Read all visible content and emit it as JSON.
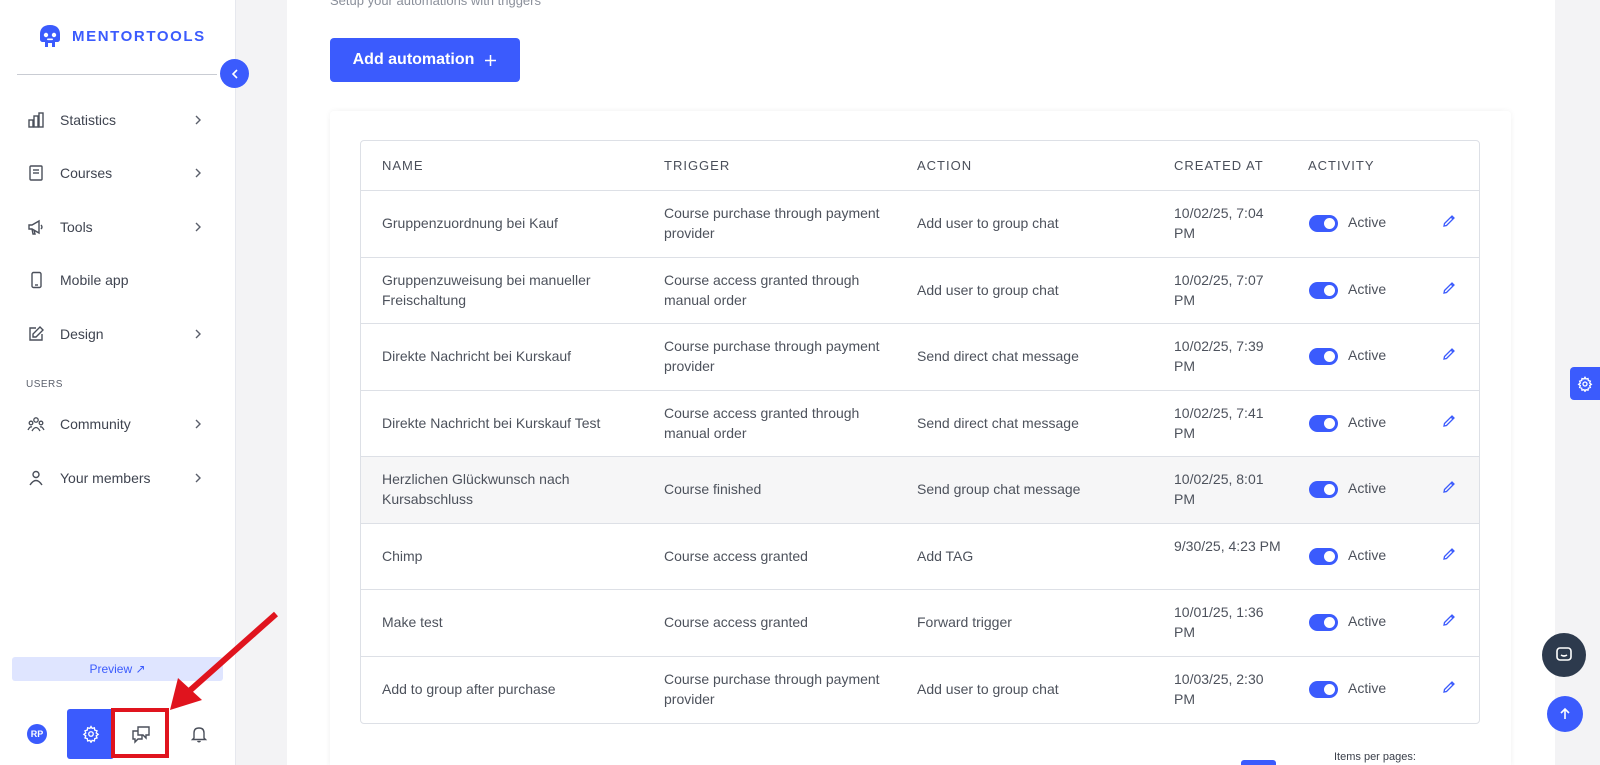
{
  "brand": {
    "name": "MENTORTOOLS",
    "color": "#3b5bfd"
  },
  "sidebar": {
    "items": [
      {
        "label": "Statistics",
        "icon": "bar-chart-icon",
        "has_chevron": true
      },
      {
        "label": "Courses",
        "icon": "book-icon",
        "has_chevron": true
      },
      {
        "label": "Tools",
        "icon": "megaphone-icon",
        "has_chevron": true
      },
      {
        "label": "Mobile app",
        "icon": "phone-icon",
        "has_chevron": false
      },
      {
        "label": "Design",
        "icon": "pencil-square-icon",
        "has_chevron": true
      }
    ],
    "section_users": "USERS",
    "user_items": [
      {
        "label": "Community",
        "icon": "users-icon",
        "has_chevron": true
      },
      {
        "label": "Your members",
        "icon": "user-icon",
        "has_chevron": true
      }
    ],
    "preview_label": "Preview ↗",
    "avatar_initials": "RP"
  },
  "main": {
    "subtitle": "Setup your automations with triggers",
    "add_button_label": "Add automation",
    "columns": [
      "NAME",
      "TRIGGER",
      "ACTION",
      "CREATED AT",
      "ACTIVITY"
    ],
    "rows": [
      {
        "name": "Gruppenzuordnung bei Kauf",
        "trigger": "Course purchase through payment provider",
        "action": "Add user to group chat",
        "created": "10/02/25, 7:04 PM",
        "status": "Active"
      },
      {
        "name": "Gruppenzuweisung bei manueller Freischaltung",
        "trigger": "Course access granted through manual order",
        "action": "Add user to group chat",
        "created": "10/02/25, 7:07 PM",
        "status": "Active"
      },
      {
        "name": "Direkte Nachricht bei Kurskauf",
        "trigger": "Course purchase through payment provider",
        "action": "Send direct chat message",
        "created": "10/02/25, 7:39 PM",
        "status": "Active"
      },
      {
        "name": "Direkte Nachricht bei Kurskauf Test",
        "trigger": "Course access granted through manual order",
        "action": "Send direct chat message",
        "created": "10/02/25, 7:41 PM",
        "status": "Active"
      },
      {
        "name": "Herzlichen Glückwunsch nach Kursabschluss",
        "trigger": "Course finished",
        "action": "Send group chat message",
        "created": "10/02/25, 8:01 PM",
        "status": "Active"
      },
      {
        "name": "Chimp",
        "trigger": "Course access granted",
        "action": "Add TAG",
        "created": "9/30/25, 4:23 PM",
        "status": "Active"
      },
      {
        "name": "Make test",
        "trigger": "Course access granted",
        "action": "Forward trigger",
        "created": "10/01/25, 1:36 PM",
        "status": "Active"
      },
      {
        "name": "Add to group after purchase",
        "trigger": "Course purchase through payment provider",
        "action": "Add user to group chat",
        "created": "10/03/25, 2:30 PM",
        "status": "Active"
      }
    ],
    "items_per_page_label": "Items per pages:"
  }
}
